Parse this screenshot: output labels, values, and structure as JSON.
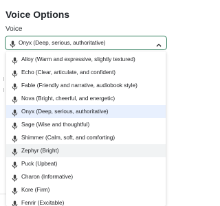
{
  "panel": {
    "title": "Voice Options",
    "voice_label": "Voice"
  },
  "select": {
    "value": "Onyx (Deep, serious, authoritative)",
    "icon": "microphone-icon",
    "chevron_icon": "chevron-up-icon"
  },
  "dropdown": {
    "options": [
      {
        "label": "Alloy (Warm and expressive, slightly textured)"
      },
      {
        "label": "Echo (Clear, articulate, and confident)"
      },
      {
        "label": "Fable (Friendly and narrative, audiobook style)"
      },
      {
        "label": "Nova (Bright, cheerful, and energetic)"
      },
      {
        "label": "Onyx (Deep, serious, authoritative)"
      },
      {
        "label": "Sage (Wise and thoughtful)"
      },
      {
        "label": "Shimmer (Calm, soft, and comforting)"
      },
      {
        "label": "Zephyr (Bright)"
      },
      {
        "label": "Puck (Upbeat)"
      },
      {
        "label": "Charon (Informative)"
      },
      {
        "label": "Kore (Firm)"
      },
      {
        "label": "Fenrir (Excitable)"
      }
    ],
    "selected_label": "Onyx (Deep, serious, authoritative)",
    "hovered_label": "Zephyr (Bright)"
  },
  "colors": {
    "accent_border": "#2e7d5b",
    "selected_bg": "#e8f0fe",
    "hover_bg": "#f1f3f4"
  }
}
